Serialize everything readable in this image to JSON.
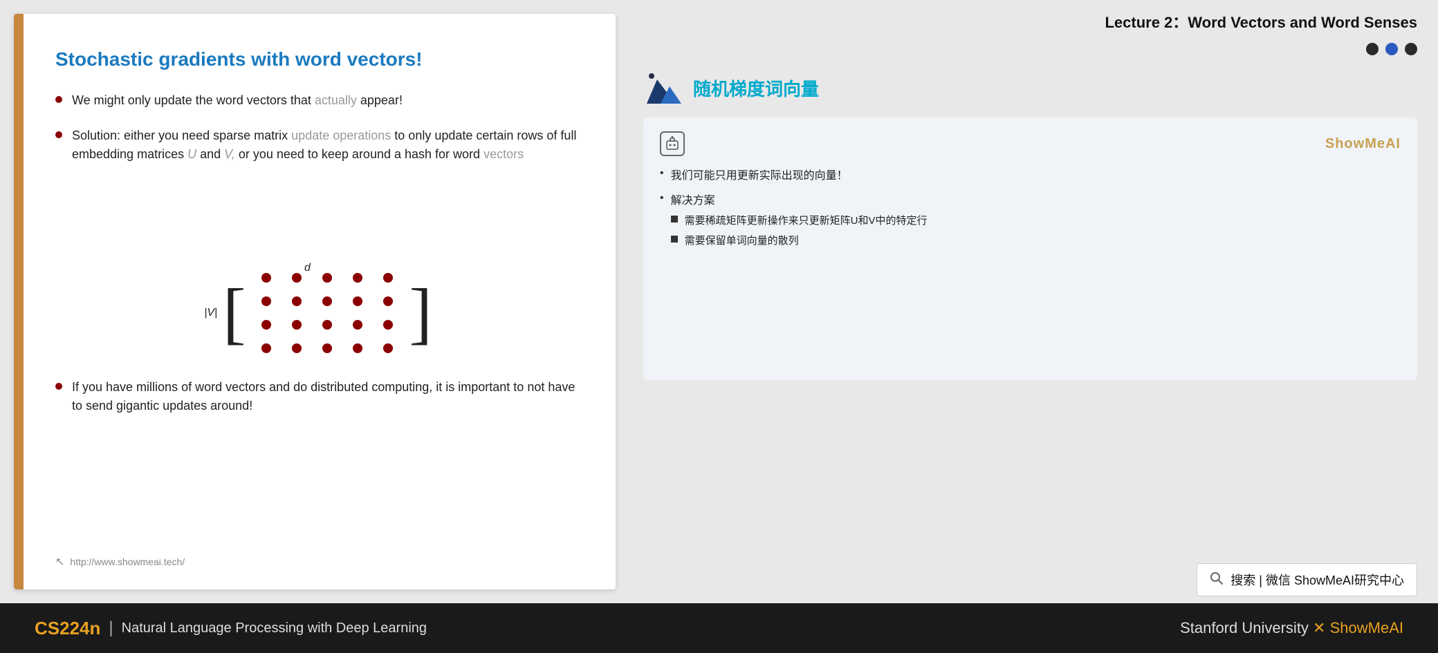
{
  "lecture": {
    "title": "Lecture 2：Word Vectors and Word Senses"
  },
  "slide": {
    "title": "Stochastic gradients with word vectors!",
    "left_bar_color": "#c8a040",
    "bullets": [
      {
        "text": "We might only update the word vectors that actually appear!"
      },
      {
        "text": "Solution: either you need sparse matrix update operations to only update certain rows of full embedding matrices U and V, or you need to keep around a hash for word vectors",
        "has_dashed": true
      },
      {
        "text": "If you have millions of word vectors and do distributed computing, it is important to not have to send gigantic updates around!"
      }
    ],
    "matrix": {
      "label_v": "|V|",
      "label_d": "d",
      "rows": 4,
      "cols": 5
    },
    "footer_url": "http://www.showmeai.tech/"
  },
  "annotation": {
    "title_cn": "随机梯度词向量",
    "brand": "ShowMeAI",
    "bullets": [
      {
        "text": "我们可能只用更新实际出现的向量！"
      },
      {
        "text": "解决方案",
        "sub_bullets": [
          "需要稀疏矩阵更新操作来只更新矩阵U和V中的特定行",
          "需要保留单词向量的散列"
        ]
      }
    ]
  },
  "nav_dots": [
    {
      "active": false
    },
    {
      "active": true
    },
    {
      "active": false
    }
  ],
  "search": {
    "text": "搜索 | 微信 ShowMeAI研究中心"
  },
  "bottom_bar": {
    "course": "CS224n",
    "subtitle": "Natural Language Processing with Deep Learning",
    "right": "Stanford University × ShowMeAI"
  }
}
